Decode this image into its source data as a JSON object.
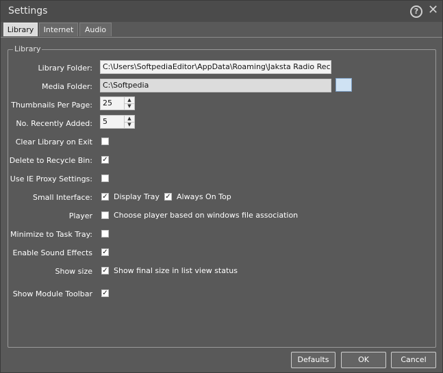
{
  "window": {
    "title": "Settings"
  },
  "tabs": [
    {
      "label": "Library"
    },
    {
      "label": "Internet"
    },
    {
      "label": "Audio"
    }
  ],
  "group": {
    "legend": "Library"
  },
  "fields": {
    "library_folder": {
      "label": "Library Folder:",
      "value": "C:\\Users\\SoftpediaEditor\\AppData\\Roaming\\Jaksta Radio Recorc"
    },
    "media_folder": {
      "label": "Media Folder:",
      "value": "C:\\Softpedia"
    },
    "thumbnails_per_page": {
      "label": "Thumbnails Per Page:",
      "value": "25"
    },
    "recently_added": {
      "label": "No. Recently Added:",
      "value": "5"
    },
    "clear_library": {
      "label": "Clear Library on Exit",
      "checked": false
    },
    "delete_recycle": {
      "label": "Delete to Recycle Bin:",
      "checked": true
    },
    "ie_proxy": {
      "label": "Use IE Proxy Settings:",
      "checked": false
    },
    "small_interface": {
      "label": "Small Interface:",
      "checked": true,
      "display_tray_label": "Display Tray",
      "always_on_top_label": "Always On Top",
      "always_on_top_checked": true
    },
    "player": {
      "label": "Player",
      "checked": false,
      "option_label": "Choose player based on windows file association"
    },
    "minimize_tray": {
      "label": "Minimize to Task Tray:",
      "checked": false
    },
    "sound_effects": {
      "label": "Enable Sound Effects",
      "checked": true
    },
    "show_size": {
      "label": "Show size",
      "checked": true,
      "option_label": "Show final size in list view status"
    },
    "module_toolbar": {
      "label": "Show Module Toolbar",
      "checked": true
    }
  },
  "buttons": {
    "defaults": "Defaults",
    "ok": "OK",
    "cancel": "Cancel"
  },
  "icons": {
    "help": "help-icon",
    "close": "close-icon",
    "browse": "folder-browse-icon"
  },
  "symbols": {
    "check": "✓",
    "help": "?",
    "close": "✕",
    "up": "▲",
    "down": "▼"
  }
}
